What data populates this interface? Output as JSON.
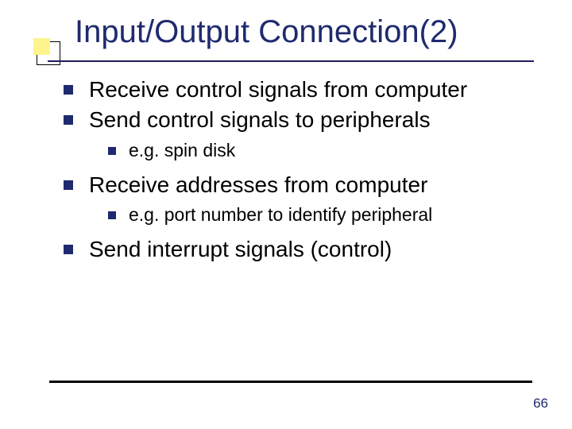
{
  "title": "Input/Output Connection(2)",
  "bullets": {
    "b1": "Receive control signals from computer",
    "b2": "Send control signals to peripherals",
    "b2a": "e.g. spin disk",
    "b3": "Receive addresses from computer",
    "b3a": "e.g. port number to identify peripheral",
    "b4": "Send interrupt signals (control)"
  },
  "page_number": "66"
}
